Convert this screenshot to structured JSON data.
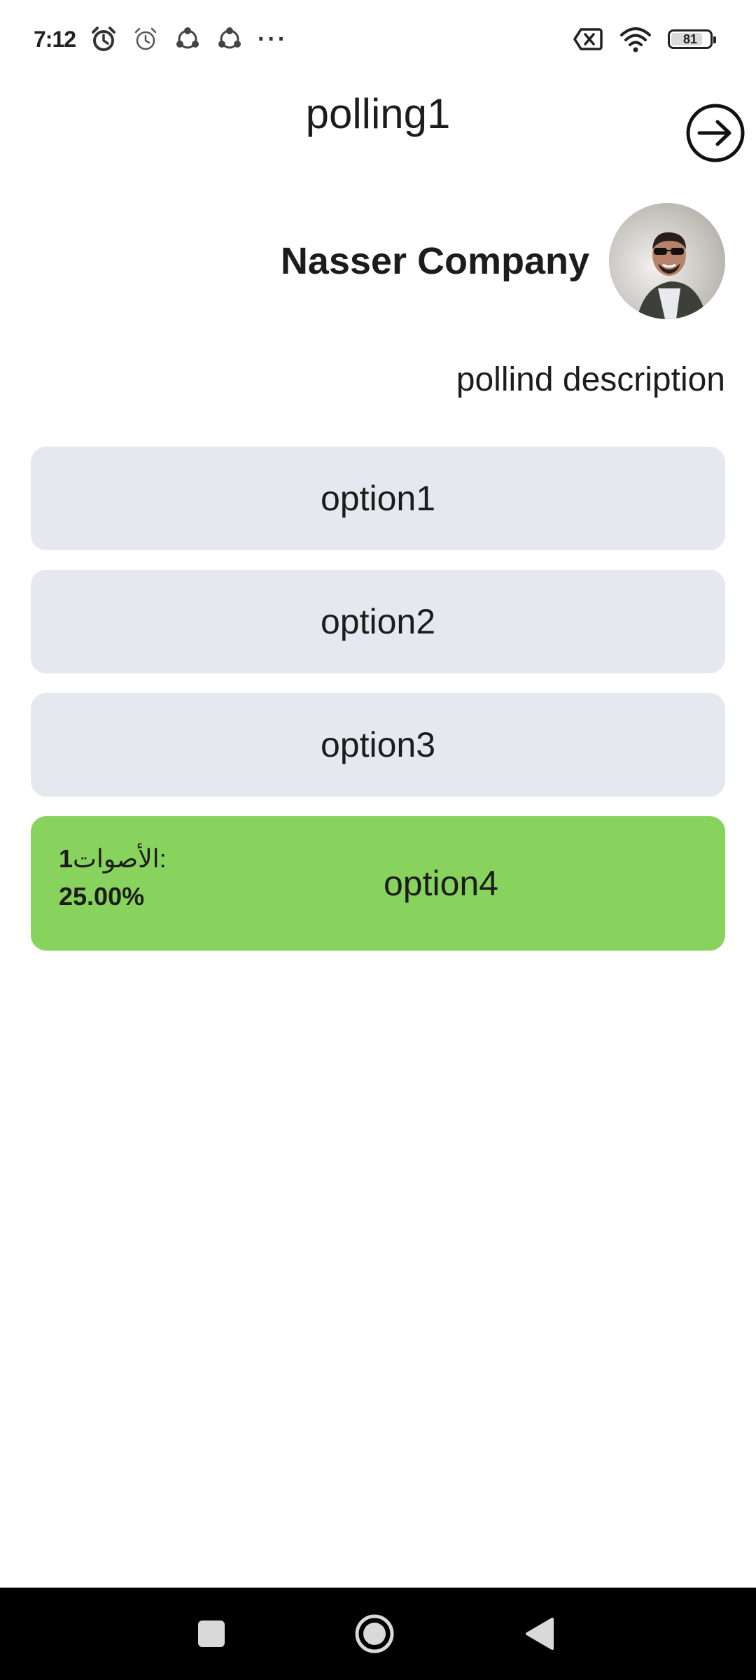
{
  "status_bar": {
    "time": "7:12",
    "more": "···",
    "battery": "81",
    "battery_level": 0.81,
    "icons": [
      "alarm-icon",
      "alarm-outline-icon",
      "share-icon",
      "share-icon",
      "sim-off-icon",
      "wifi-icon",
      "battery-icon"
    ]
  },
  "header": {
    "title": "polling1",
    "exit_icon": "arrow-right-circle-icon"
  },
  "poll": {
    "company_name": "Nasser Company",
    "description": "pollind description",
    "options": [
      {
        "label": "option1",
        "selected": false
      },
      {
        "label": "option2",
        "selected": false
      },
      {
        "label": "option3",
        "selected": false
      },
      {
        "label": "option4",
        "selected": true,
        "votes_label": "الأصوات:",
        "votes_count": "1",
        "percent": "25.00%"
      }
    ]
  },
  "colors": {
    "option_bg": "#e5e8ef",
    "selected_bg": "#88d35e",
    "navbar_bg": "#000000"
  },
  "nav": {
    "icons": [
      "recents-square-icon",
      "home-circle-icon",
      "back-triangle-icon"
    ]
  }
}
